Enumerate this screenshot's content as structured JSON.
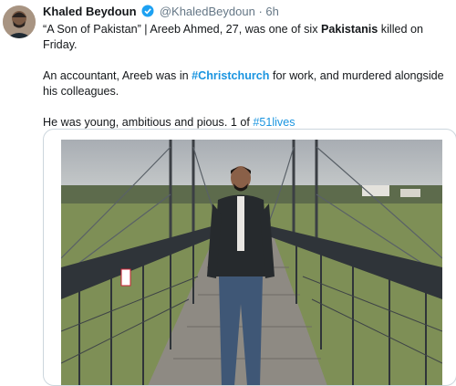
{
  "tweet": {
    "author_name": "Khaled Beydoun",
    "handle": "@KhaledBeydoun",
    "separator": "·",
    "time": "6h",
    "line1_a": "“A Son of Pakistan” | Areeb Ahmed, 27, was one of six ",
    "line1_bold": "Pakistanis",
    "line1_b": " killed on Friday.",
    "line2_a": "An accountant, Areeb was in ",
    "line2_tag": "#Christchurch",
    "line2_b": " for work, and murdered alongside his colleagues.",
    "line3_a": "He was young, ambitious and pious. 1 of ",
    "line3_tag": "#51lives"
  },
  "icons": {
    "verified": "verified-badge-icon"
  },
  "colors": {
    "link": "#1b95e0",
    "verified": "#1da1f2",
    "secondary_text": "#657786"
  }
}
